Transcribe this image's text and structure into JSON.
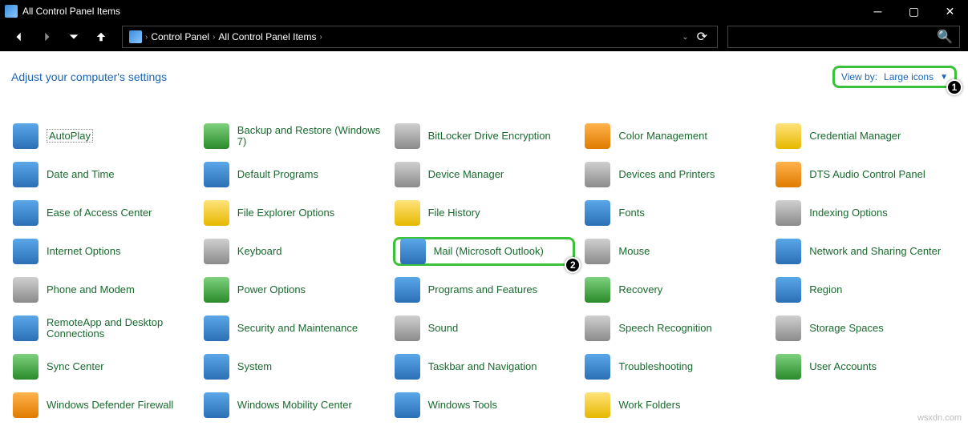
{
  "title_bar": {
    "title": "All Control Panel Items"
  },
  "breadcrumbs": [
    "Control Panel",
    "All Control Panel Items"
  ],
  "search": {
    "placeholder": ""
  },
  "heading": "Adjust your computer's settings",
  "view_by": {
    "label": "View by:",
    "value": "Large icons"
  },
  "annotations": {
    "viewby_badge": "1",
    "mail_badge": "2"
  },
  "watermark": "wsxdn.com",
  "items": [
    {
      "label": "AutoPlay",
      "icon_color": "ic-blue",
      "selected": true
    },
    {
      "label": "Backup and Restore (Windows 7)",
      "icon_color": "ic-green"
    },
    {
      "label": "BitLocker Drive Encryption",
      "icon_color": "ic-gray"
    },
    {
      "label": "Color Management",
      "icon_color": "ic-orange"
    },
    {
      "label": "Credential Manager",
      "icon_color": "ic-yellow"
    },
    {
      "label": "Date and Time",
      "icon_color": "ic-blue"
    },
    {
      "label": "Default Programs",
      "icon_color": "ic-blue"
    },
    {
      "label": "Device Manager",
      "icon_color": "ic-gray"
    },
    {
      "label": "Devices and Printers",
      "icon_color": "ic-gray"
    },
    {
      "label": "DTS Audio Control Panel",
      "icon_color": "ic-orange"
    },
    {
      "label": "Ease of Access Center",
      "icon_color": "ic-blue"
    },
    {
      "label": "File Explorer Options",
      "icon_color": "ic-yellow"
    },
    {
      "label": "File History",
      "icon_color": "ic-yellow"
    },
    {
      "label": "Fonts",
      "icon_color": "ic-blue"
    },
    {
      "label": "Indexing Options",
      "icon_color": "ic-gray"
    },
    {
      "label": "Internet Options",
      "icon_color": "ic-blue"
    },
    {
      "label": "Keyboard",
      "icon_color": "ic-gray"
    },
    {
      "label": "Mail (Microsoft Outlook)",
      "icon_color": "ic-blue",
      "highlight": true,
      "badge": "2"
    },
    {
      "label": "Mouse",
      "icon_color": "ic-gray"
    },
    {
      "label": "Network and Sharing Center",
      "icon_color": "ic-blue"
    },
    {
      "label": "Phone and Modem",
      "icon_color": "ic-gray"
    },
    {
      "label": "Power Options",
      "icon_color": "ic-green"
    },
    {
      "label": "Programs and Features",
      "icon_color": "ic-blue"
    },
    {
      "label": "Recovery",
      "icon_color": "ic-green"
    },
    {
      "label": "Region",
      "icon_color": "ic-blue"
    },
    {
      "label": "RemoteApp and Desktop Connections",
      "icon_color": "ic-blue"
    },
    {
      "label": "Security and Maintenance",
      "icon_color": "ic-blue"
    },
    {
      "label": "Sound",
      "icon_color": "ic-gray"
    },
    {
      "label": "Speech Recognition",
      "icon_color": "ic-gray"
    },
    {
      "label": "Storage Spaces",
      "icon_color": "ic-gray"
    },
    {
      "label": "Sync Center",
      "icon_color": "ic-green"
    },
    {
      "label": "System",
      "icon_color": "ic-blue"
    },
    {
      "label": "Taskbar and Navigation",
      "icon_color": "ic-blue"
    },
    {
      "label": "Troubleshooting",
      "icon_color": "ic-blue"
    },
    {
      "label": "User Accounts",
      "icon_color": "ic-green"
    },
    {
      "label": "Windows Defender Firewall",
      "icon_color": "ic-orange"
    },
    {
      "label": "Windows Mobility Center",
      "icon_color": "ic-blue"
    },
    {
      "label": "Windows Tools",
      "icon_color": "ic-blue"
    },
    {
      "label": "Work Folders",
      "icon_color": "ic-yellow"
    }
  ]
}
